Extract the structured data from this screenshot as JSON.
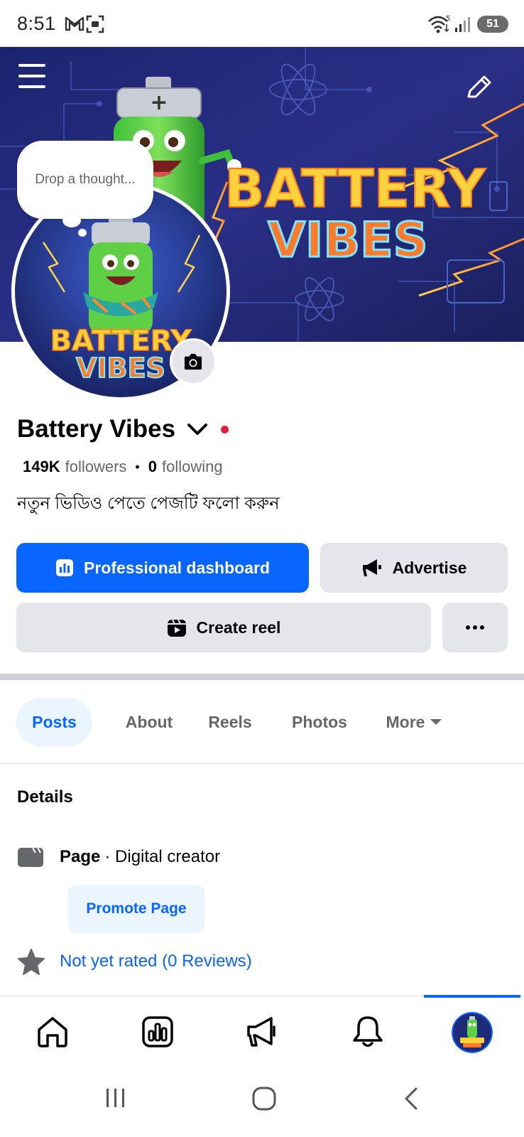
{
  "status_bar": {
    "time": "8:51",
    "battery_level": "51",
    "signal_label": "5"
  },
  "cover": {
    "cover_text_line1": "BATTERY",
    "cover_text_line2": "VIBES"
  },
  "thought_bubble": {
    "placeholder": "Drop a thought..."
  },
  "profile": {
    "name": "Battery Vibes",
    "followers_count": "149K",
    "followers_label": "followers",
    "following_count": "0",
    "following_label": "following",
    "bio": "নতুন ভিডিও পেতে পেজটি ফলো করুন"
  },
  "actions": {
    "professional_dashboard": "Professional dashboard",
    "advertise": "Advertise",
    "create_reel": "Create reel",
    "more": "···"
  },
  "tabs": [
    {
      "label": "Posts",
      "active": true
    },
    {
      "label": "About",
      "active": false
    },
    {
      "label": "Reels",
      "active": false
    },
    {
      "label": "Photos",
      "active": false
    },
    {
      "label": "More",
      "active": false
    }
  ],
  "details": {
    "title": "Details",
    "page_label": "Page",
    "category": "· Digital creator",
    "promote_label": "Promote Page",
    "rating_text": "Not yet rated (0 Reviews)"
  },
  "bottom_nav": {
    "items": [
      "home-icon",
      "insights-icon",
      "megaphone-icon",
      "bell-icon",
      "profile-avatar"
    ]
  },
  "colors": {
    "primary": "#0866ff",
    "button_gray": "#e4e6eb",
    "text_secondary": "#65676b",
    "notification_dot": "#e41e3f"
  }
}
